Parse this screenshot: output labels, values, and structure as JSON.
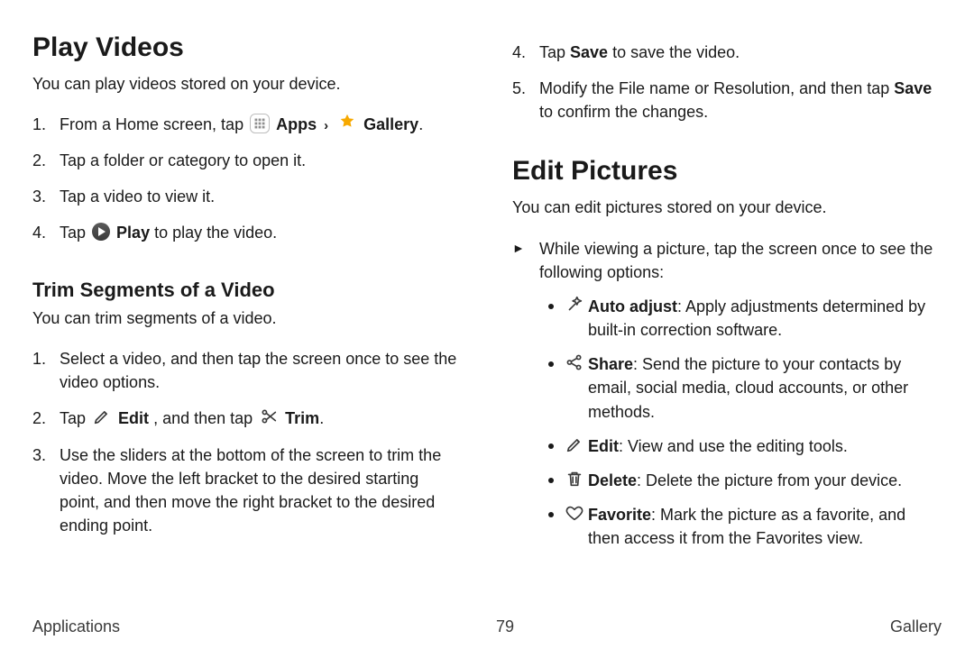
{
  "left": {
    "section_title": "Play Videos",
    "intro": "You can play videos stored on your device.",
    "steps": {
      "s1a": "From a Home screen, tap ",
      "s1_apps": "Apps",
      "s1_gal": "Gallery",
      "s1_dot": ".",
      "s2": "Tap a folder or category to open it.",
      "s3": "Tap a video to view it.",
      "s4a": "Tap ",
      "s4_play": "Play",
      "s4b": " to play the video."
    },
    "sub_title": "Trim Segments of a Video",
    "sub_intro": "You can trim segments of a video.",
    "sub_steps": {
      "t1": "Select a video, and then tap the screen once to see the video options.",
      "t2a": "Tap ",
      "t2_edit": "Edit",
      "t2b": ", and then tap ",
      "t2_trim": "Trim",
      "t2c": ".",
      "t3": "Use the sliders at the bottom of the screen to trim the video. Move the left bracket to the desired starting point, and then move the right bracket to the desired ending point."
    }
  },
  "right": {
    "top_steps": {
      "r4a": "Tap ",
      "r4_save": "Save",
      "r4b": " to save the video.",
      "r5a": "Modify the File name or Resolution, and then tap ",
      "r5_save": "Save",
      "r5b": " to confirm the changes."
    },
    "section_title": "Edit Pictures",
    "intro": "You can edit pictures stored on your device.",
    "arrow_item": "While viewing a picture, tap the screen once to see the following options:",
    "options": {
      "auto_name": "Auto adjust",
      "auto_desc": ": Apply adjustments determined by built-in correction software.",
      "share_name": "Share",
      "share_desc": ": Send the picture to your contacts by email, social media, cloud accounts, or other methods.",
      "edit_name": "Edit",
      "edit_desc": ": View and use the editing tools.",
      "delete_name": "Delete",
      "delete_desc": ": Delete the picture from your device.",
      "fav_name": "Favorite",
      "fav_desc": ": Mark the picture as a favorite, and then access it from the Favorites view."
    }
  },
  "footer": {
    "left": "Applications",
    "page": "79",
    "right": "Gallery"
  }
}
